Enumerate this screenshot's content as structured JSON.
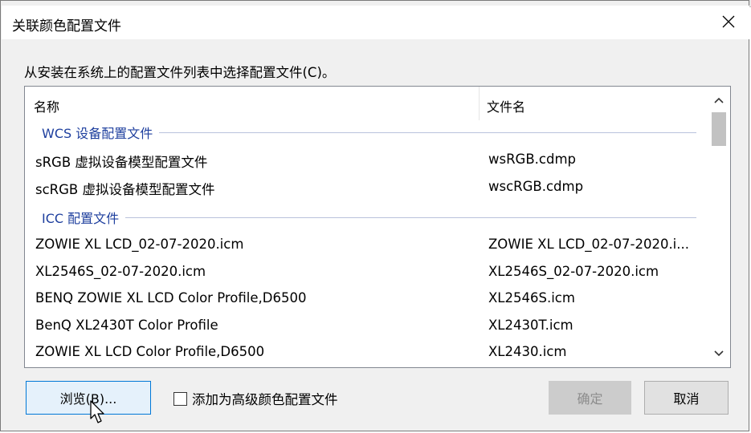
{
  "dialog": {
    "title": "关联颜色配置文件",
    "instruction": "从安装在系统上的配置文件列表中选择配置文件(C)。"
  },
  "list": {
    "columns": [
      "名称",
      "文件名"
    ],
    "groups": [
      {
        "label": "WCS 设备配置文件",
        "rows": [
          {
            "name": "sRGB 虚拟设备模型配置文件",
            "file": "wsRGB.cdmp"
          },
          {
            "name": "scRGB 虚拟设备模型配置文件",
            "file": "wscRGB.cdmp"
          }
        ]
      },
      {
        "label": "ICC 配置文件",
        "rows": [
          {
            "name": "ZOWIE XL LCD_02-07-2020.icm",
            "file": "ZOWIE XL LCD_02-07-2020.i..."
          },
          {
            "name": "XL2546S_02-07-2020.icm",
            "file": "XL2546S_02-07-2020.icm"
          },
          {
            "name": "BENQ ZOWIE XL LCD Color Profile,D6500",
            "file": "XL2546S.icm"
          },
          {
            "name": "BenQ XL2430T Color Profile",
            "file": "XL2430T.icm"
          },
          {
            "name": "ZOWIE XL LCD Color Profile,D6500",
            "file": "XL2430.icm"
          }
        ]
      }
    ]
  },
  "buttons": {
    "browse": "浏览(B)...",
    "ok": "确定",
    "cancel": "取消"
  },
  "checkbox": {
    "label": "添加为高级颜色配置文件",
    "checked": false
  },
  "icons": {
    "close": "close-icon",
    "scroll_up": "chevron-up-icon",
    "scroll_down": "chevron-down-icon",
    "cursor": "mouse-pointer-icon"
  }
}
